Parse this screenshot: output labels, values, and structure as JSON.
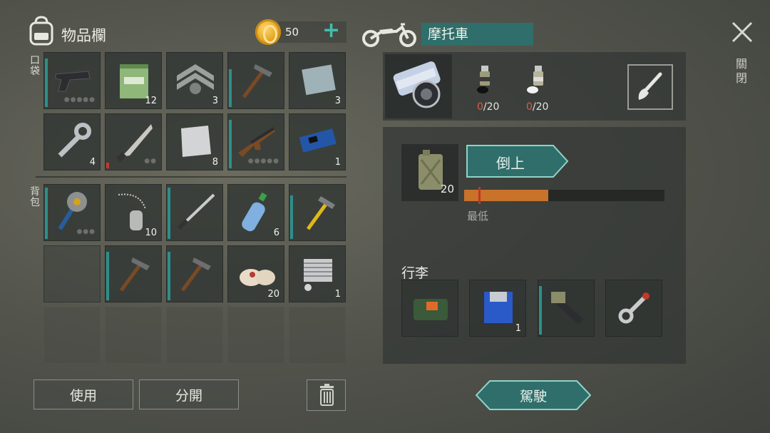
{
  "inventory": {
    "title": "物品欄",
    "coins": "50",
    "add_label": "+",
    "pockets_label": "口袋",
    "backpack_label": "背包",
    "pocket_slots": [
      {
        "icon": "pistol-icon",
        "count": "",
        "durability": 0.9,
        "dots": "●●●●●"
      },
      {
        "icon": "notebook-icon",
        "count": "12",
        "durability": null,
        "dots": ""
      },
      {
        "icon": "chevron-patch-icon",
        "count": "3",
        "durability": null,
        "dots": ""
      },
      {
        "icon": "pickaxe-icon",
        "count": "",
        "durability": 0.7,
        "dots": ""
      },
      {
        "icon": "metal-plate-icon",
        "count": "3",
        "durability": null,
        "dots": ""
      },
      {
        "icon": "wrench-icon",
        "count": "4",
        "durability": null,
        "dots": ""
      },
      {
        "icon": "machete-icon",
        "count": "",
        "durability": 0.1,
        "dots": "●●"
      },
      {
        "icon": "steel-sheet-icon",
        "count": "8",
        "durability": null,
        "dots": ""
      },
      {
        "icon": "rifle-icon",
        "count": "",
        "durability": 0.9,
        "dots": "●●●●●"
      },
      {
        "icon": "circuit-board-icon",
        "count": "1",
        "durability": null,
        "dots": ""
      }
    ],
    "backpack_slots": [
      {
        "icon": "sawblade-mace-icon",
        "count": "",
        "durability": 0.95,
        "dots": "●●●"
      },
      {
        "icon": "dog-tag-icon",
        "count": "10",
        "durability": null,
        "dots": ""
      },
      {
        "icon": "katana-icon",
        "count": "",
        "durability": 0.95,
        "dots": ""
      },
      {
        "icon": "water-bottle-icon",
        "count": "6",
        "durability": null,
        "dots": ""
      },
      {
        "icon": "hammer-icon",
        "count": "",
        "durability": 0.8,
        "dots": ""
      },
      {
        "icon": "",
        "count": "",
        "durability": null,
        "dots": ""
      },
      {
        "icon": "pickaxe-icon",
        "count": "",
        "durability": 0.9,
        "dots": ""
      },
      {
        "icon": "pickaxe-icon",
        "count": "",
        "durability": 0.9,
        "dots": ""
      },
      {
        "icon": "bandage-icon",
        "count": "20",
        "durability": null,
        "dots": ""
      },
      {
        "icon": "engine-cylinder-icon",
        "count": "1",
        "durability": null,
        "dots": ""
      }
    ],
    "use_button": "使用",
    "split_button": "分開"
  },
  "vehicle": {
    "name": "摩托車",
    "close_label": "關閉",
    "paint_count_1": {
      "current": "0",
      "max": "/20"
    },
    "paint_count_2": {
      "current": "0",
      "max": "/20"
    },
    "fuel_amount": "20",
    "pour_button": "倒上",
    "fuel_level": 0.42,
    "min_marker": 0.07,
    "min_label": "最低",
    "luggage_title": "行李",
    "luggage": [
      {
        "icon": "explosive-pack-icon",
        "count": "",
        "durability": null
      },
      {
        "icon": "floppy-disk-icon",
        "count": "1",
        "durability": null
      },
      {
        "icon": "minigun-icon",
        "count": "",
        "durability": 0.9
      },
      {
        "icon": "connecting-rod-icon",
        "count": "",
        "durability": null
      }
    ],
    "drive_button": "駕駛"
  },
  "colors": {
    "accent": "#2f6e6a",
    "fuel": "#c8722a",
    "marker": "#c2342a",
    "coin": "#e0a21e"
  }
}
